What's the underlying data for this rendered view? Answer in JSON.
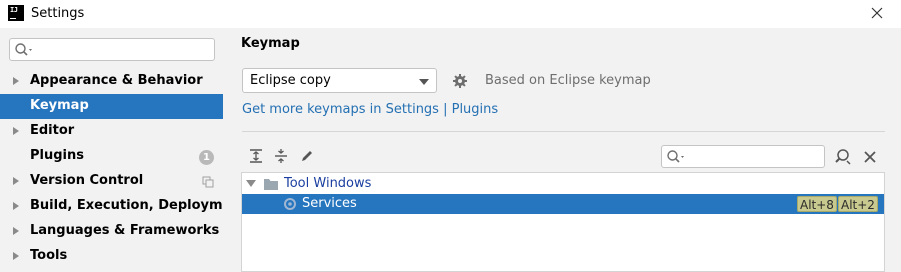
{
  "window": {
    "title": "Settings",
    "logo_text": "IJ"
  },
  "sidebar": {
    "search_placeholder": "",
    "items": [
      {
        "label": "Appearance & Behavior",
        "expandable": true,
        "selected": false
      },
      {
        "label": "Keymap",
        "expandable": false,
        "selected": true
      },
      {
        "label": "Editor",
        "expandable": true,
        "selected": false
      },
      {
        "label": "Plugins",
        "expandable": false,
        "selected": false,
        "badge": "1"
      },
      {
        "label": "Version Control",
        "expandable": true,
        "selected": false
      },
      {
        "label": "Build, Execution, Deployment",
        "expandable": true,
        "selected": false
      },
      {
        "label": "Languages & Frameworks",
        "expandable": true,
        "selected": false
      },
      {
        "label": "Tools",
        "expandable": true,
        "selected": false
      }
    ]
  },
  "main": {
    "title": "Keymap",
    "keymap_select": {
      "value": "Eclipse copy"
    },
    "based_on": "Based on Eclipse keymap",
    "link_text": "Get more keymaps in Settings | Plugins",
    "tree_search_placeholder": "",
    "tree": [
      {
        "label": "Tool Windows",
        "level": 0,
        "expanded": true,
        "selected": false
      },
      {
        "label": "Services",
        "level": 1,
        "selected": true,
        "shortcuts": [
          "Alt+8",
          "Alt+2"
        ]
      }
    ]
  },
  "colors": {
    "accent": "#2675bf",
    "link": "#2470b3",
    "shortcut_bg": "#c7c98f"
  },
  "icons": {
    "search": "search-icon",
    "gear": "gear-icon",
    "expand_all": "expand-all-icon",
    "collapse_all": "collapse-all-icon",
    "edit": "pencil-icon",
    "find_shortcut": "find-shortcut-icon",
    "clear": "close-icon",
    "folder": "folder-icon",
    "copy": "copy-icon"
  }
}
